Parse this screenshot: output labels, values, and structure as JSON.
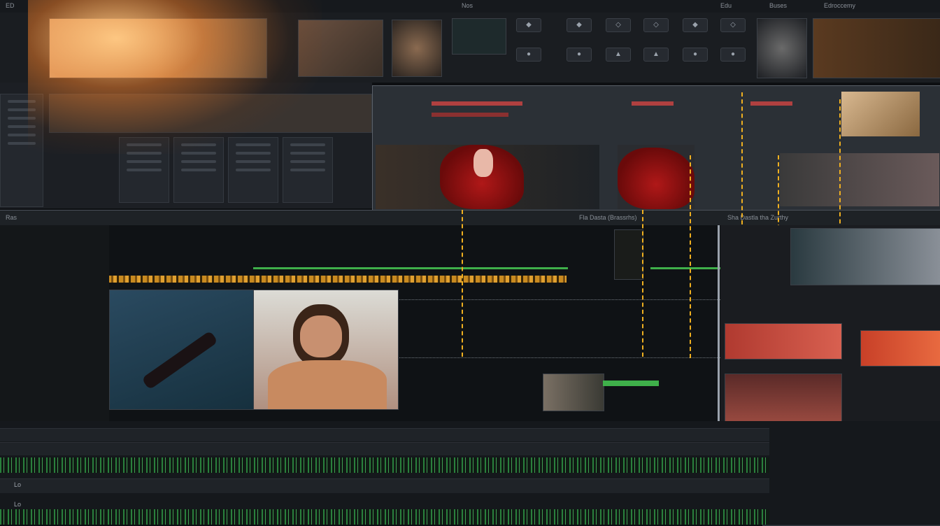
{
  "topbar": {
    "items": [
      "ED",
      "Nos",
      "Edu",
      "Buses",
      "Edroccemy"
    ]
  },
  "ruler": {
    "left_text": "Ras",
    "center_text": "Fla Dasta (Brassrhs)",
    "right_text": "Sha Dastla tha Zurthy"
  },
  "timeline": {
    "track_labels": [
      "Lo",
      "Lo"
    ]
  },
  "colors": {
    "accent_orange": "#f0b020",
    "audio_green": "#3fb04a",
    "viewer_red": "#b01818"
  }
}
